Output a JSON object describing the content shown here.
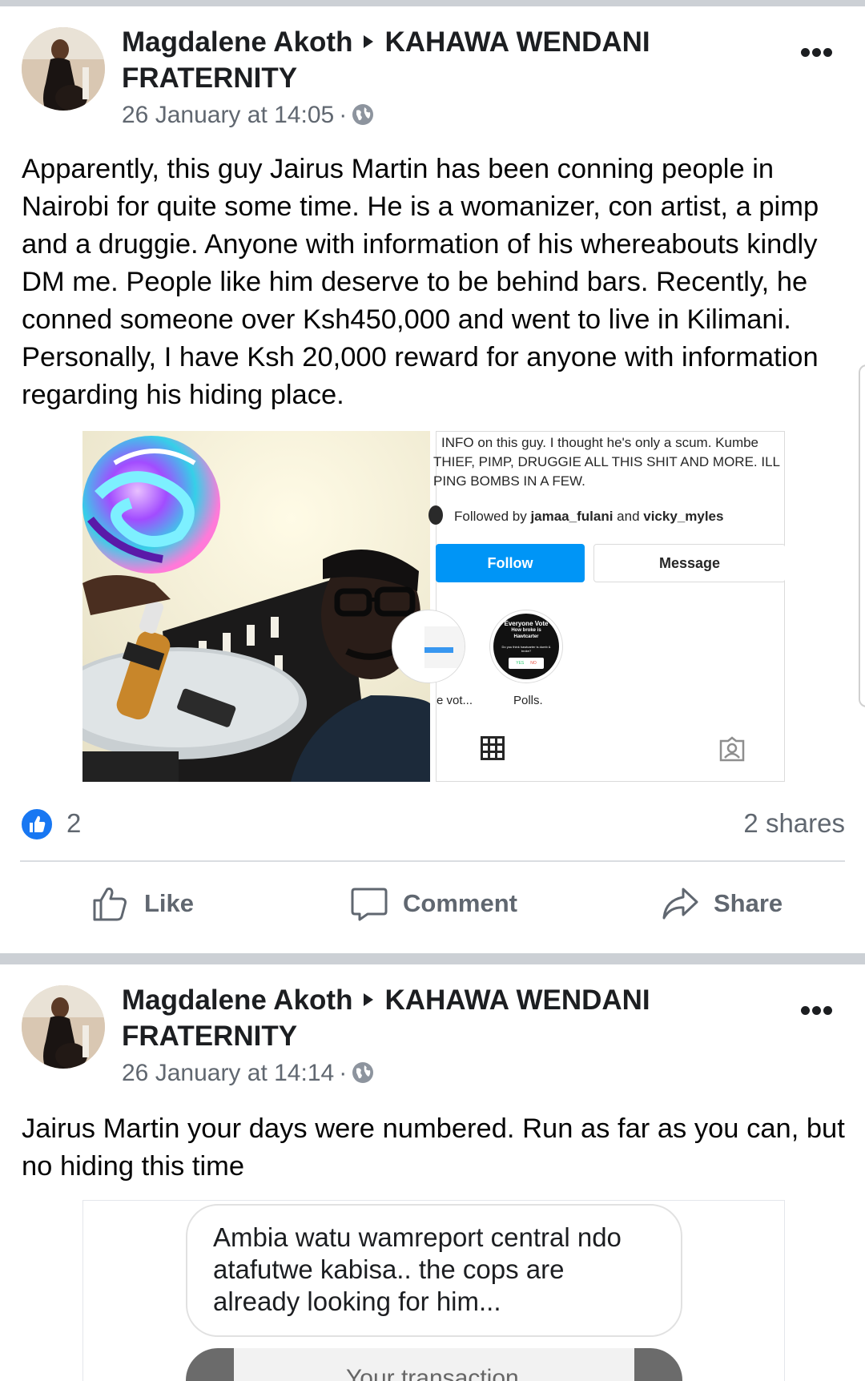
{
  "posts": [
    {
      "author": "Magdalene Akoth",
      "group": "KAHAWA WENDANI FRATERNITY",
      "timestamp": "26 January at 14:05",
      "meta_sep": "·",
      "text": "Apparently, this guy Jairus Martin has been conning people in Nairobi for quite some time. He is a womanizer, con artist, a pimp and a druggie. Anyone with information of his whereabouts kindly DM me. People like him deserve to be behind bars. Recently, he conned someone over Ksh450,000 and went to live in Kilimani. Personally, I have Ksh 20,000 reward for anyone with information regarding his hiding place.",
      "instagram": {
        "bio_line1": "INFO on this guy. I thought he's only a scum. Kumbe",
        "bio_line2": "THIEF, PIMP, DRUGGIE ALL THIS SHIT AND MORE. ILL",
        "bio_line3": "PING BOMBS IN A FEW.",
        "followed_prefix": "Followed by ",
        "followed_user1": "jamaa_fulani",
        "followed_and": " and ",
        "followed_user2": "vicky_myles",
        "follow_label": "Follow",
        "message_label": "Message",
        "highlight1_label": "e vot...",
        "highlight2_label": "Polls.",
        "poll_title": "Everyone Vote",
        "poll_subtitle": "How broke is Hawtcarter",
        "poll_question": "Do you think hawtcarter is dumb & broke?",
        "poll_yes": "YES",
        "poll_no": "NO"
      },
      "like_count": "2",
      "shares": "2 shares"
    },
    {
      "author": "Magdalene Akoth",
      "group": "KAHAWA WENDANI FRATERNITY",
      "timestamp": "26 January at 14:14",
      "meta_sep": "·",
      "text": "Jairus Martin your days were numbered. Run as far as you can, but no hiding this time",
      "chat": {
        "message": "Ambia watu wamreport central ndo atafutwe kabisa.. the cops are already looking for him...",
        "partial_text": "Your transaction"
      }
    }
  ],
  "actions": {
    "like": "Like",
    "comment": "Comment",
    "share": "Share"
  },
  "colors": {
    "facebook_blue": "#1877f2",
    "instagram_blue": "#0095f6",
    "secondary_text": "#606770"
  }
}
